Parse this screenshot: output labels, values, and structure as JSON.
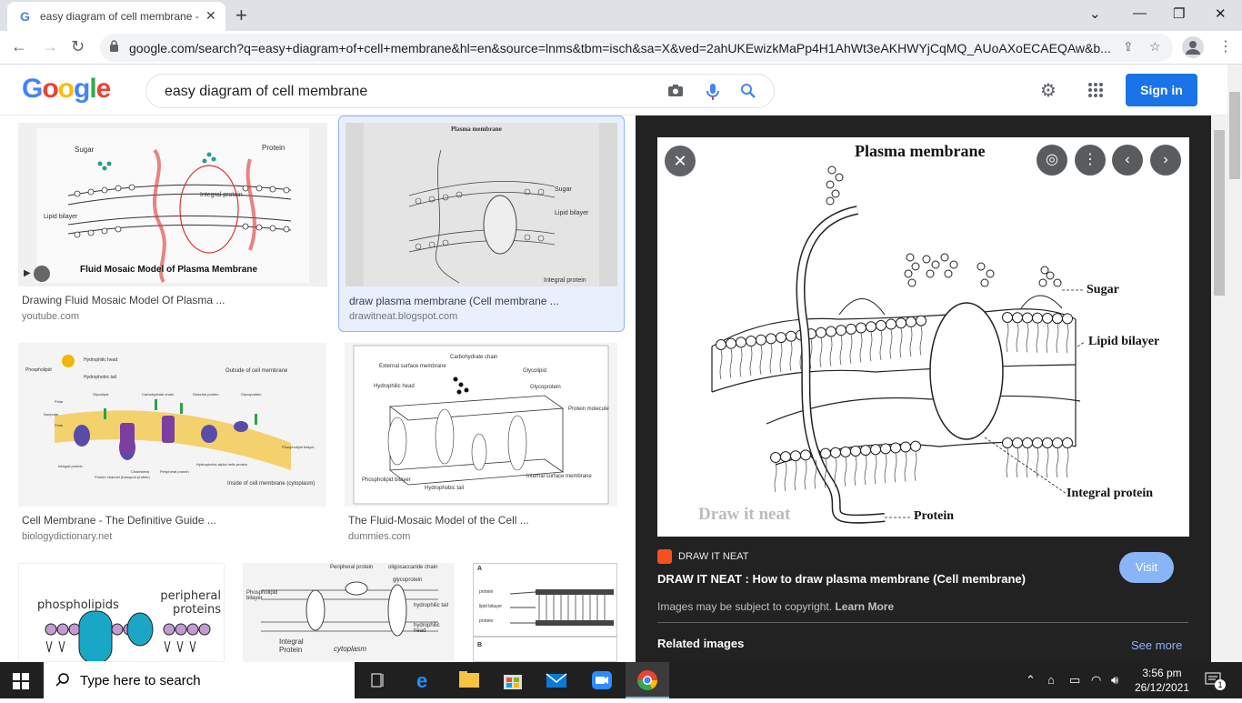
{
  "browser": {
    "tab_title": "easy diagram of cell membrane -",
    "url": "google.com/search?q=easy+diagram+of+cell+membrane&hl=en&source=lnms&tbm=isch&sa=X&ved=2ahUKEwizkMaPp4H1AhWt3eAKHWYjCqMQ_AUoAXoECAEQAw&b..."
  },
  "google": {
    "logo": [
      "G",
      "o",
      "o",
      "g",
      "l",
      "e"
    ],
    "logo_colors": [
      "#4285f4",
      "#ea4335",
      "#fbbc05",
      "#4285f4",
      "#34a853",
      "#ea4335"
    ],
    "query": "easy diagram of cell membrane",
    "signin": "Sign in"
  },
  "results": [
    {
      "title": "Drawing Fluid Mosaic Model Of Plasma ...",
      "source": "youtube.com",
      "thumb_caption": "Fluid Mosaic Model of Plasma Membrane",
      "labels": [
        "Sugar",
        "Protein",
        "Integral protein",
        "Lipid bilayer"
      ]
    },
    {
      "title": "draw plasma membrane (Cell membrane ...",
      "source": "drawitneat.blogspot.com",
      "labels": [
        "Plasma membrane",
        "Sugar",
        "Lipid bilayer",
        "Integral protein"
      ]
    },
    {
      "title": "Cell Membrane - The Definitive Guide ...",
      "source": "biologydictionary.net",
      "labels": [
        "Hydrophilic head",
        "Phospholipid",
        "Hydrophobic tail",
        "Outside of cell membrane",
        "Glycolipid",
        "Carbohydrate chain",
        "Globular protein",
        "Glycoprotein",
        "Polar",
        "Nonpolar",
        "Polar",
        "Phospholipid bilayer",
        "Integral protein",
        "Cholesterol",
        "Peripheral protein",
        "Hydrophobic alpha helix protein",
        "Protein channel (transport protein)",
        "Inside of cell membrane (cytoplasm)"
      ]
    },
    {
      "title": "The Fluid-Mosaic Model of the Cell ...",
      "source": "dummies.com",
      "labels": [
        "Carbohydrate chain",
        "External surface membrane",
        "Glycolipid",
        "Hydrophilic head",
        "Glycoprotein",
        "Protein molecule",
        "Phospholipid bilayer",
        "Hydrophobic tail",
        "Internal surface membrane"
      ]
    },
    {
      "title": "",
      "source": "",
      "labels": [
        "phospholipids",
        "peripheral proteins"
      ]
    },
    {
      "title": "",
      "source": "",
      "labels": [
        "Peripheral protein",
        "oligosaccaride chain",
        "glycoprotein",
        "Phospholipid bilayer",
        "Integral Protein",
        "cytoplasm",
        "hydrophilic tail",
        "hydrophilic head"
      ]
    },
    {
      "title": "",
      "source": "",
      "labels": [
        "A",
        "protein",
        "lipid bilayer",
        "protein",
        "B"
      ]
    }
  ],
  "preview": {
    "image_title": "Plasma membrane",
    "labels": [
      "Sugar",
      "Lipid bilayer",
      "Integral protein",
      "Protein"
    ],
    "watermark": "Draw it neat",
    "site": "DRAW IT NEAT",
    "title": "DRAW IT NEAT : How to draw plasma membrane (Cell membrane)",
    "visit": "Visit",
    "copyright": "Images may be subject to copyright.",
    "learn_more": "Learn More",
    "related": "Related images",
    "see_more": "See more"
  },
  "taskbar": {
    "search_placeholder": "Type here to search",
    "time": "3:56 pm",
    "date": "26/12/2021",
    "notification_count": "1"
  }
}
